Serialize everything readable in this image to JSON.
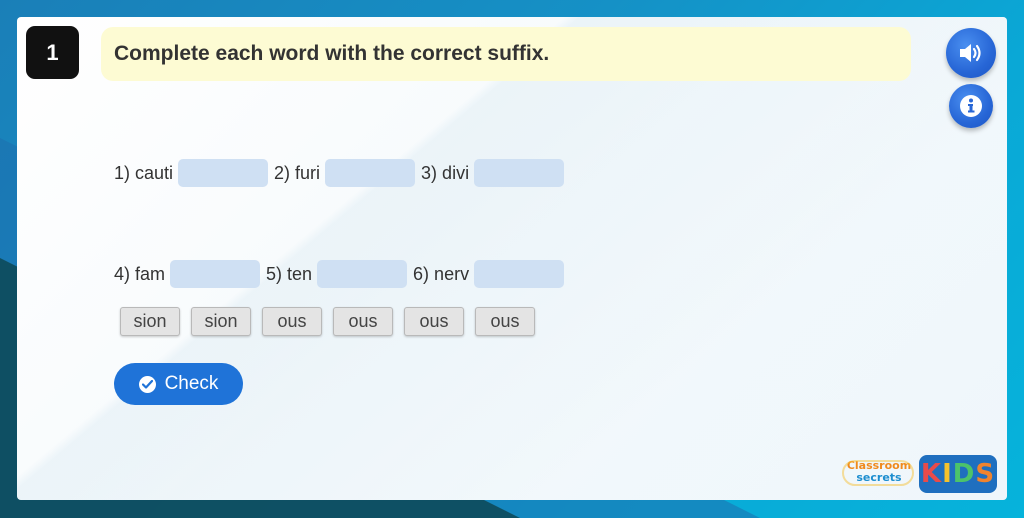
{
  "question": {
    "number": "1",
    "instruction": "Complete each word with the correct suffix."
  },
  "rows": [
    [
      {
        "label": "1) cauti"
      },
      {
        "label": "2) furi"
      },
      {
        "label": "3) divi"
      }
    ],
    [
      {
        "label": "4) fam"
      },
      {
        "label": "5) ten"
      },
      {
        "label": "6) nerv"
      }
    ]
  ],
  "suffix_tiles": [
    "sion",
    "sion",
    "ous",
    "ous",
    "ous",
    "ous"
  ],
  "check_button": {
    "label": "Check"
  },
  "logos": {
    "classroom_line1": "Classroom",
    "classroom_line2": "secrets",
    "kids": [
      "K",
      "I",
      "D",
      "S"
    ]
  },
  "icons": {
    "audio": "speaker-icon",
    "info": "info-icon",
    "check": "check-circle-icon"
  },
  "colors": {
    "accent": "#1f73d8",
    "instruction_bg": "#fdfbd3",
    "slot_bg": "#cfe0f3"
  }
}
